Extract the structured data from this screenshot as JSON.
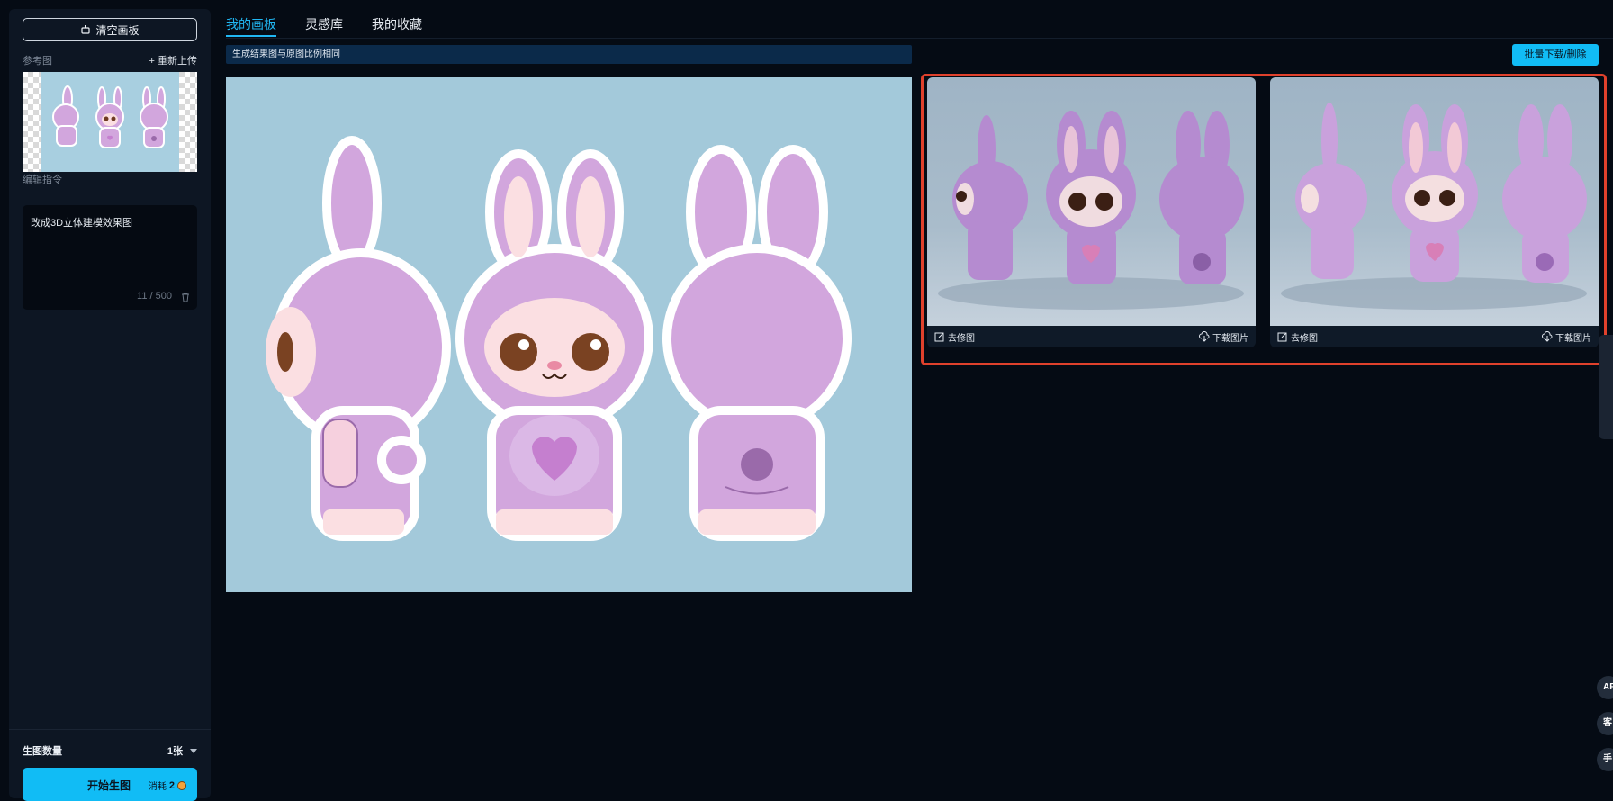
{
  "left_panel": {
    "clear_canvas_label": "清空画板",
    "reference_label": "参考图",
    "reupload_label": "+ 重新上传",
    "instruction_label": "编辑指令",
    "prompt_text": "改成3D立体建模效果图",
    "prompt_count": "11 / 500",
    "quantity_label": "生图数量",
    "quantity_value": "1张",
    "start_label": "开始生图",
    "cost_prefix": "消耗",
    "cost_value": "2"
  },
  "tabs": [
    {
      "label": "我的画板",
      "active": true
    },
    {
      "label": "灵感库",
      "active": false
    },
    {
      "label": "我的收藏",
      "active": false
    }
  ],
  "canvas": {
    "notice": "生成结果图与原图比例相同",
    "batch_label": "批量下载/删除"
  },
  "results": [
    {
      "retouch_label": "去修图",
      "download_label": "下载图片",
      "style": "fluffy purple bunny figures"
    },
    {
      "retouch_label": "去修图",
      "download_label": "下载图片",
      "style": "glossy purple bunny figures"
    }
  ],
  "float_buttons": [
    "AP",
    "客",
    "手"
  ],
  "colors": {
    "accent": "#11bcf5",
    "background": "#050b14",
    "panel": "#0d1623",
    "highlight_frame": "#e0412c",
    "bunny_purple": "#d2a6dd"
  }
}
